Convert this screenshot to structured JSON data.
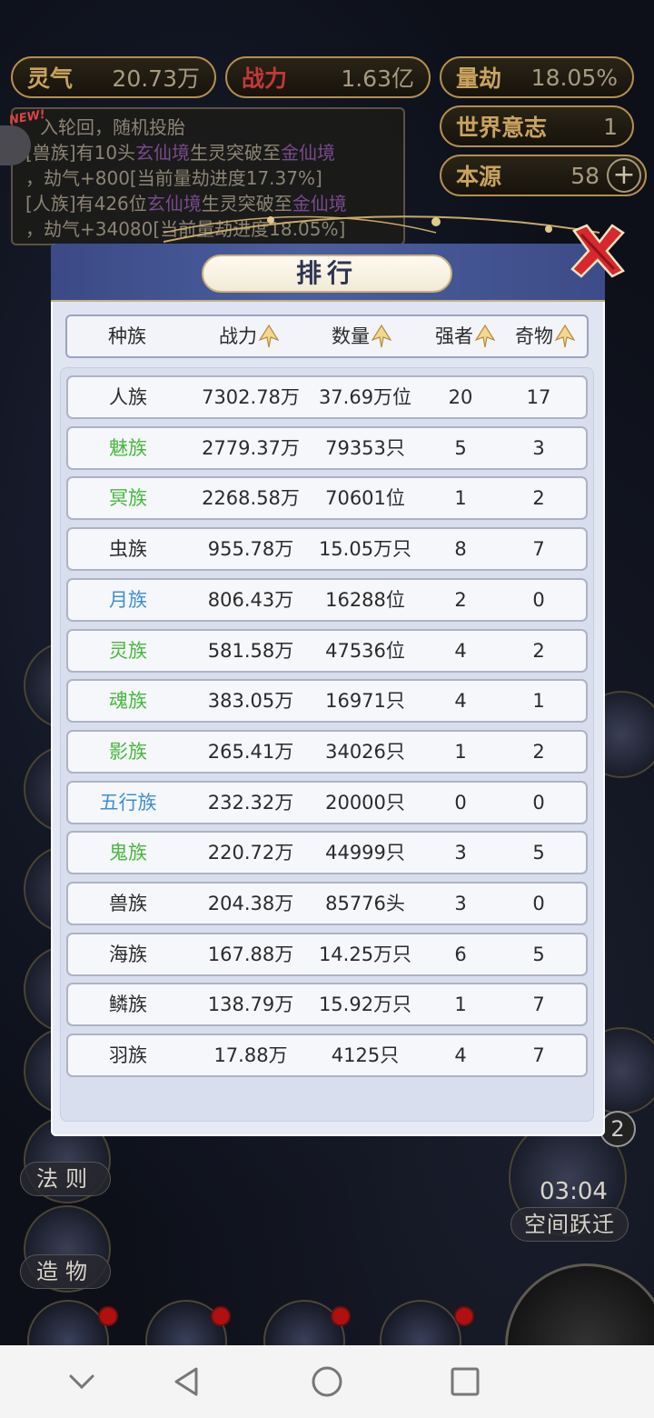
{
  "resources": {
    "spirit_label": "灵气",
    "spirit_value": "20.73万",
    "power_label": "战力",
    "power_value": "1.63亿",
    "calamity_label": "量劫",
    "calamity_value": "18.05%",
    "will_label": "世界意志",
    "will_value": "1",
    "origin_label": "本源",
    "origin_value": "58"
  },
  "log": {
    "new_badge": "NEW!",
    "line1": "入轮回，随机投胎",
    "line2_pre": "[兽族]有10头",
    "line2_hl1": "玄仙境",
    "line2_mid": "生灵突破至",
    "line2_hl2": "金仙境",
    "line3": "，劫气+800[当前量劫进度17.37%]",
    "line4_pre": "[人族]有426位",
    "line4_hl1": "玄仙境",
    "line4_mid": "生灵突破至",
    "line4_hl2": "金仙境",
    "line5": "，劫气+34080[当前量劫进度18.05%]"
  },
  "side": {
    "law_label": "法则",
    "create_label": "造物",
    "timer": "03:04",
    "space_jump": "空间跃迁",
    "badge": "2"
  },
  "dialog": {
    "title": "排行",
    "headers": [
      "种族",
      "战力",
      "数量",
      "强者",
      "奇物"
    ]
  },
  "colors": {
    "black": "#2b2b2b",
    "green": "#46b83c",
    "blue": "#3c8fd2"
  },
  "rows": [
    {
      "race": "人族",
      "power": "7302.78万",
      "count": "37.69万位",
      "strong": "20",
      "treasure": "17",
      "color": "black"
    },
    {
      "race": "魅族",
      "power": "2779.37万",
      "count": "79353只",
      "strong": "5",
      "treasure": "3",
      "color": "green"
    },
    {
      "race": "冥族",
      "power": "2268.58万",
      "count": "70601位",
      "strong": "1",
      "treasure": "2",
      "color": "green"
    },
    {
      "race": "虫族",
      "power": "955.78万",
      "count": "15.05万只",
      "strong": "8",
      "treasure": "7",
      "color": "black"
    },
    {
      "race": "月族",
      "power": "806.43万",
      "count": "16288位",
      "strong": "2",
      "treasure": "0",
      "color": "blue"
    },
    {
      "race": "灵族",
      "power": "581.58万",
      "count": "47536位",
      "strong": "4",
      "treasure": "2",
      "color": "green"
    },
    {
      "race": "魂族",
      "power": "383.05万",
      "count": "16971只",
      "strong": "4",
      "treasure": "1",
      "color": "green"
    },
    {
      "race": "影族",
      "power": "265.41万",
      "count": "34026只",
      "strong": "1",
      "treasure": "2",
      "color": "green"
    },
    {
      "race": "五行族",
      "power": "232.32万",
      "count": "20000只",
      "strong": "0",
      "treasure": "0",
      "color": "blue"
    },
    {
      "race": "鬼族",
      "power": "220.72万",
      "count": "44999只",
      "strong": "3",
      "treasure": "5",
      "color": "green"
    },
    {
      "race": "兽族",
      "power": "204.38万",
      "count": "85776头",
      "strong": "3",
      "treasure": "0",
      "color": "black"
    },
    {
      "race": "海族",
      "power": "167.88万",
      "count": "14.25万只",
      "strong": "6",
      "treasure": "5",
      "color": "black"
    },
    {
      "race": "鳞族",
      "power": "138.79万",
      "count": "15.92万只",
      "strong": "1",
      "treasure": "7",
      "color": "black"
    },
    {
      "race": "羽族",
      "power": "17.88万",
      "count": "4125只",
      "strong": "4",
      "treasure": "7",
      "color": "black"
    }
  ]
}
